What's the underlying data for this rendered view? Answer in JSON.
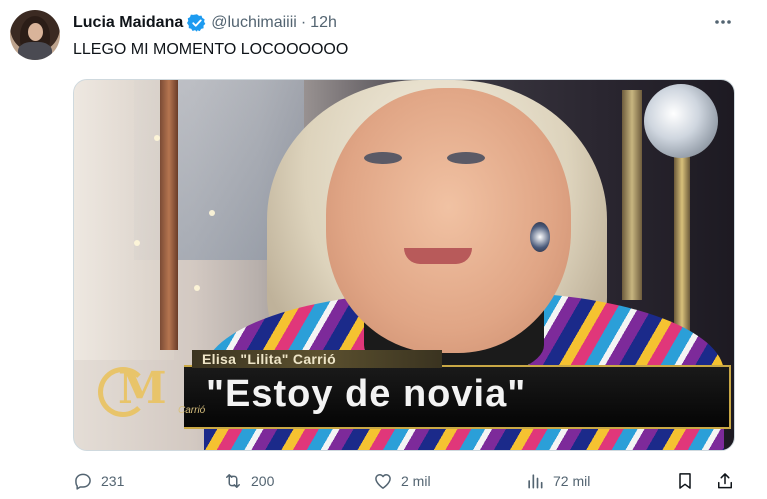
{
  "author": {
    "display_name": "Lucia Maidana",
    "handle": "@luchimaiiii",
    "separator": "·",
    "time": "12h"
  },
  "tweet_text": "LLEGO MI MOMENTO LOCOOOOOO",
  "media": {
    "caption_name": "Elisa \"Lilita\" Carrió",
    "caption_quote": "\"Estoy de novia\"",
    "logo_sub": "Carrió"
  },
  "actions": {
    "reply_count": "231",
    "retweet_count": "200",
    "like_count": "2 mil",
    "view_count": "72 mil"
  },
  "colors": {
    "verified": "#1d9bf0",
    "muted": "#536471",
    "text": "#0f1419"
  },
  "icons": [
    "verified-badge-icon",
    "more-options-icon",
    "reply-icon",
    "retweet-icon",
    "like-icon",
    "views-icon",
    "bookmark-icon",
    "share-icon"
  ]
}
